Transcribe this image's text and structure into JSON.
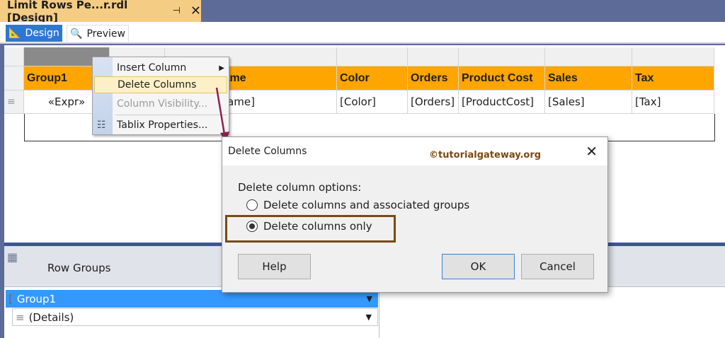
{
  "document_tab": {
    "title": "Limit Rows Pe...r.rdl [Design]",
    "pin_icon": "pin-icon",
    "close_icon": "close-icon"
  },
  "toolbar": {
    "design_label": "Design",
    "preview_label": "Preview"
  },
  "tablix": {
    "headers": [
      "Group1",
      "",
      "Name",
      "Color",
      "Orders",
      "Product Cost",
      "Sales",
      "Tax"
    ],
    "cells": [
      "«Expr»",
      "",
      "[Name]",
      "[Color]",
      "[Orders]",
      "[ProductCost]",
      "[Sales]",
      "[Tax]"
    ],
    "header_color": "#ffa500"
  },
  "context_menu": {
    "items": [
      {
        "label": "Insert Column",
        "submenu": true
      },
      {
        "label": "Delete Columns",
        "highlighted": true
      },
      {
        "label": "Column Visibility...",
        "disabled": true
      },
      {
        "label": "Tablix Properties..."
      }
    ]
  },
  "dialog": {
    "title": "Delete Columns",
    "watermark": "©tutorialgateway.org",
    "group_label": "Delete column options:",
    "options": [
      {
        "label": "Delete columns and associated groups",
        "selected": false
      },
      {
        "label": "Delete columns only",
        "selected": true
      }
    ],
    "help_label": "Help",
    "ok_label": "OK",
    "cancel_label": "Cancel"
  },
  "row_groups": {
    "title": "Row Groups",
    "items": [
      {
        "label": "Group1",
        "selected": true
      },
      {
        "label": "(Details)",
        "selected": false
      }
    ]
  },
  "annotation_color": "#8b2252"
}
